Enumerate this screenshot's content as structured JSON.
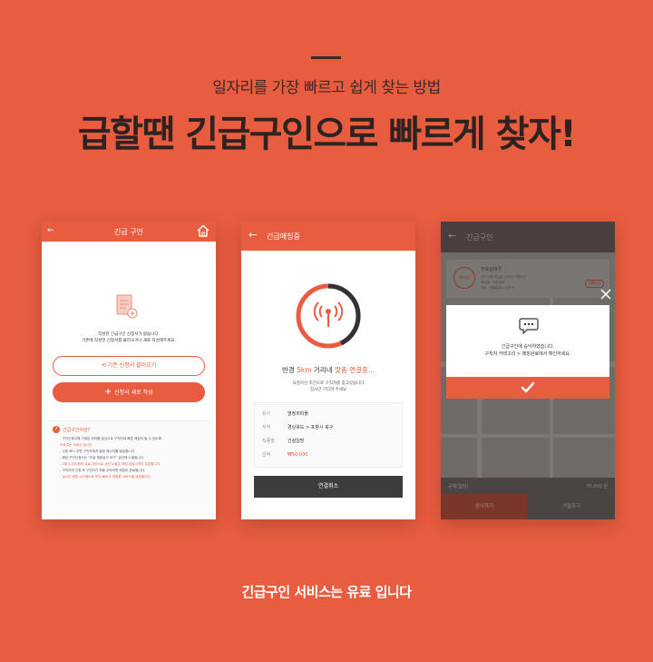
{
  "intro": {
    "subtitle": "일자리를 가장 빠르고 쉽게 찾는 방법",
    "headline": "급할땐 긴급구인으로 빠르게 찾자!",
    "footer_note": "긴급구인 서비스는 유료 입니다"
  },
  "phone1": {
    "title": "긴급 구인",
    "back_icon": "←",
    "info_line1": "작성된 긴급구인 신청서가 없습니다.",
    "info_line2": "기존에 작성한 신청서를 불러오거나 새로 작성해주세요.",
    "load_button": "기존 신청서 불러오기",
    "new_button": "신청서 새로 작성",
    "help_title": "긴급구인이란?",
    "help_lines": [
      "- 구인신청서에 기재된 위치를 중심으로 구직자와 빠른 매칭이 될 수 있도록",
      "  도와주는 서비스 입니다.",
      "- 신청 즉시 주변 구직자에게 알림 메시지를 발송합니다.",
      "- 해당 구인신청서는 \"오늘 채용공고 보기\" 상단에 노출됩니다.",
      "- 1회 5,000원의 유료 서비스로 상단 노출은 매칭 성공시까지 유효합니다.",
      "- 구직자의 신청 후 구인자가 최종 수락하면 매칭이 완료됩니다.",
      "- 실시간 매칭 시스템으로 보다 빠르고 정확한 서비스를 제공합니다."
    ]
  },
  "phone2": {
    "title": "긴급매칭중",
    "back_icon": "←",
    "conn_prefix": "반경 ",
    "conn_highlight1": "5km",
    "conn_middle": " 거리내 ",
    "conn_highlight2": "맞춤 연결중...",
    "conn_sub1": "요청하신 조건으로 구직자를 찾고있습니다",
    "conn_sub2": "잠시만 기다려 주세요",
    "rows": [
      {
        "key": "회사",
        "value": "열정피피플"
      },
      {
        "key": "지역",
        "value": "경상북도 > 포항시 북구"
      },
      {
        "key": "직종별",
        "value": "건설일방"
      },
      {
        "key": "금액",
        "value": "₩50,000"
      }
    ],
    "cancel_button": "연결취소"
  },
  "phone3": {
    "title": "긴급구인",
    "back_icon": "←",
    "card_name": "부호순대국",
    "card_circle": "매익당",
    "card_line1": "인기 서빙 하실분 급하게 구합니다",
    "card_line2": "희망별 : 서빙일방",
    "card_line3": "지역 : 서울특별시 금천구",
    "card_tag": "지원하기",
    "modal_line1": "긴급구인에 승낙하였습니다.",
    "modal_line2": "구직자 카테고리 > 매칭완료에서 확인하세요.",
    "pay_label": "공예(일당)",
    "pay_amount": "70,000 원",
    "accept_button": "승낙하기",
    "reject_button": "거절하기"
  },
  "colors": {
    "brand": "#e85c3f",
    "dark": "#2e2320"
  },
  "icons": [
    "home-icon",
    "document-icon",
    "refresh-icon",
    "plus-icon",
    "question-icon",
    "radar-icon",
    "chat-icon",
    "check-icon",
    "close-icon"
  ]
}
